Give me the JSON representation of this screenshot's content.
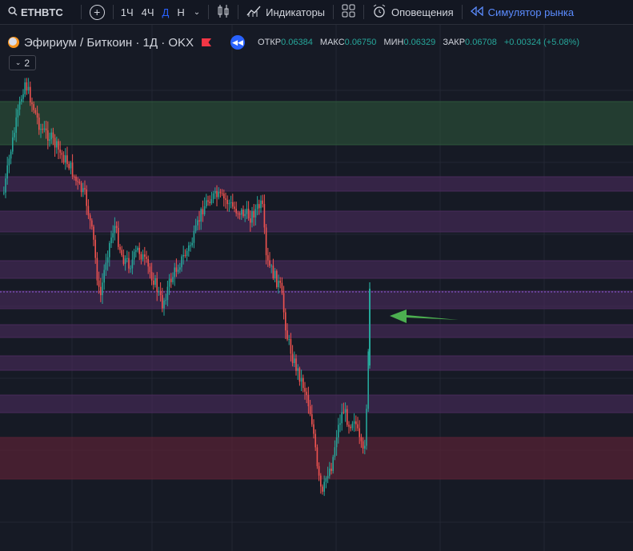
{
  "toolbar": {
    "symbol": "ETHBTC",
    "timeframes": [
      "1Ч",
      "4Ч",
      "Д",
      "Н"
    ],
    "active_timeframe": "Д",
    "indicators_label": "Индикаторы",
    "alerts_label": "Оповещения",
    "replay_label": "Симулятор рынка"
  },
  "legend": {
    "title": "Эфириум / Биткоин · 1Д · OKX",
    "open_label": "ОТКР",
    "open": "0.06384",
    "high_label": "МАКС",
    "high": "0.06750",
    "low_label": "МИН",
    "low": "0.06329",
    "close_label": "ЗАКР",
    "close": "0.06708",
    "change": "+0.00324 (+5.08%)",
    "collapsed_count": "2"
  },
  "colors": {
    "up": "#26a69a",
    "down": "#ef5350",
    "accent": "#2962ff",
    "zone_green": "#2f5b3c",
    "zone_purple": "#4b2b5e",
    "zone_red": "#5a2234",
    "arrow": "#4caf50"
  }
}
